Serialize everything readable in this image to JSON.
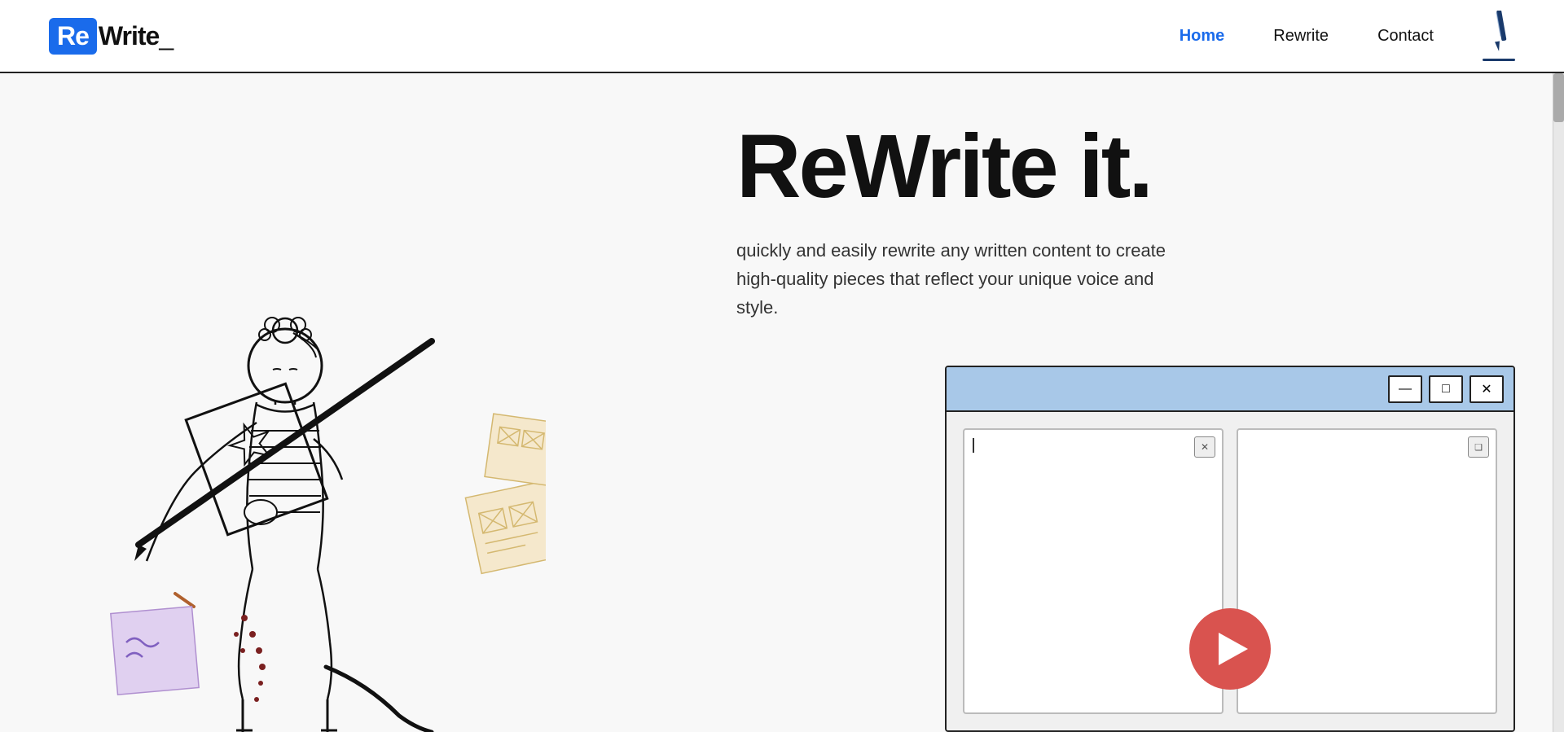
{
  "logo": {
    "re_label": "Re",
    "write_label": "Write",
    "cursor": "_"
  },
  "nav": {
    "links": [
      {
        "label": "Home",
        "active": true
      },
      {
        "label": "Rewrite",
        "active": false
      },
      {
        "label": "Contact",
        "active": false
      }
    ],
    "icon_alt": "pen icon"
  },
  "hero": {
    "title": "ReWrite it.",
    "subtitle": "quickly and easily rewrite any written content to create high-quality pieces that reflect your unique voice and style."
  },
  "window": {
    "btn_minimize": "—",
    "btn_maximize": "□",
    "btn_close": "✕",
    "panel1_close": "✕",
    "panel2_copy": "❏"
  },
  "colors": {
    "blue_accent": "#1a6beb",
    "logo_bg": "#1a6beb",
    "nav_active": "#1a6beb",
    "window_bar": "#a8c8e8",
    "play_btn": "#d9534f",
    "border": "#222"
  }
}
